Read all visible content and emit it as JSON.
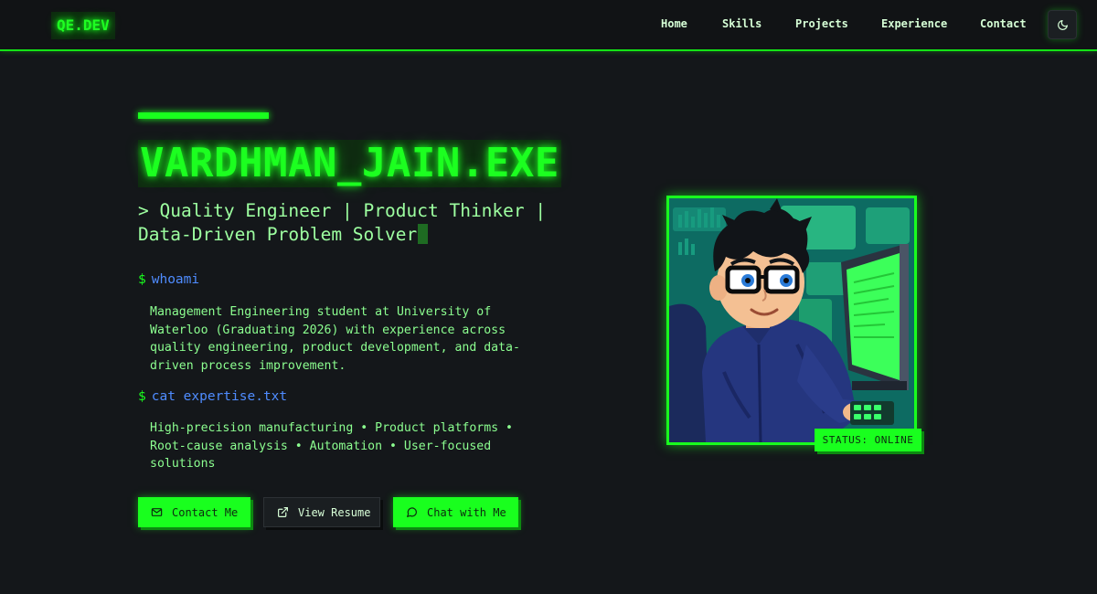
{
  "brand": {
    "logo": "QE.DEV"
  },
  "nav": {
    "items": [
      {
        "label": "Home"
      },
      {
        "label": "Skills"
      },
      {
        "label": "Projects"
      },
      {
        "label": "Experience"
      },
      {
        "label": "Contact"
      }
    ],
    "theme_icon": "moon-icon"
  },
  "hero": {
    "title": "VARDHMAN_JAIN.EXE",
    "subtitle_line1": "> Quality Engineer | Product Thinker |",
    "subtitle_line2": "Data-Driven Problem Solver",
    "prompt_symbol": "$",
    "command1": "whoami",
    "bio": "Management Engineering student at University of Waterloo (Graduating 2026) with experience across quality engineering, product development, and data-driven process improvement.",
    "command2": "cat expertise.txt",
    "expertise": "High-precision manufacturing • Product platforms • Root-cause analysis • Automation • User-focused solutions"
  },
  "buttons": {
    "contact": {
      "label": "Contact Me",
      "icon": "mail-icon"
    },
    "resume": {
      "label": "View Resume",
      "icon": "external-link-icon"
    },
    "chat": {
      "label": "Chat with Me",
      "icon": "chat-bubble-icon"
    }
  },
  "avatar": {
    "status": "STATUS: ONLINE"
  },
  "colors": {
    "accent": "#19ff1e",
    "background": "#14171a",
    "command": "#4f8cff"
  }
}
